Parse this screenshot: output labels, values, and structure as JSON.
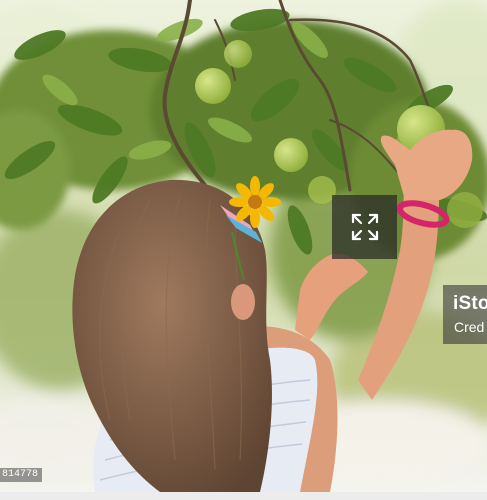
{
  "photo": {
    "alt": "",
    "colors": {
      "foliage": "#5b7d2e",
      "apple": "#a7c24a",
      "hair": "#7a5a44",
      "skin": "#e6a07c",
      "flower": "#f5b800",
      "bracelet": "#d4246a",
      "dress": "#e7ecf4"
    }
  },
  "expand_button": {
    "icon": "expand-arrows-icon"
  },
  "watermark": {
    "brand": "iStock",
    "credit": "Cred"
  },
  "image_id": "814778",
  "colors": {
    "overlay_dark": "#282828",
    "bottom_bar": "#ececec"
  }
}
